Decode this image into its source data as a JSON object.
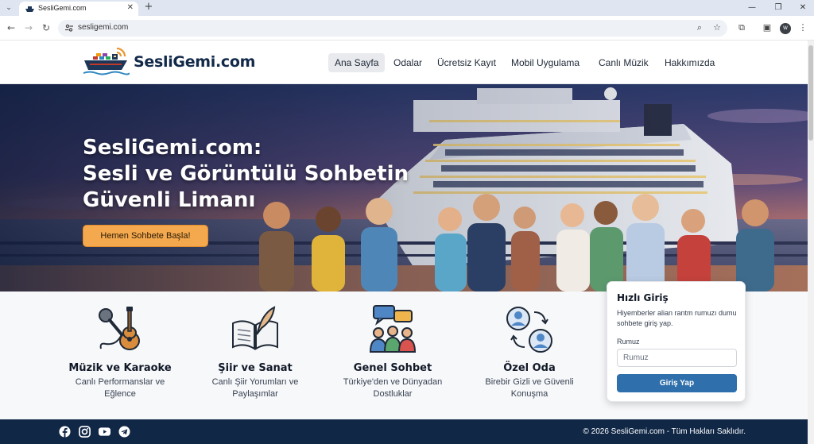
{
  "browser": {
    "tab_title": "SesliGemi.com",
    "url": "sesligemi.com",
    "profile_initials": "W"
  },
  "site": {
    "logo_text": "SesliGemi.com",
    "nav": [
      "Ana Sayfa",
      "Odalar",
      "Ücretsiz Kayıt",
      "Mobil Uygulama",
      "Canlı Müzik",
      "Hakkımızda"
    ],
    "active_nav": "Ana Sayfa"
  },
  "hero": {
    "title_lines": [
      "SesliGemi.com:",
      "Sesli ve Görüntülü Sohbetin",
      "Güvenli Limanı"
    ],
    "cta_label": "Hemen Sohbete Başla!"
  },
  "features": [
    {
      "title": "Müzik ve Karaoke",
      "desc_lines": [
        "Canlı Performanslar ve",
        "Eğlence"
      ],
      "icon": "microphone-guitar-icon"
    },
    {
      "title": "Şiir ve Sanat",
      "desc_lines": [
        "Canlı Şiir Yorumları ve",
        "Paylaşımlar"
      ],
      "icon": "book-quill-icon"
    },
    {
      "title": "Genel Sohbet",
      "desc_lines": [
        "Türkiye'den ve Dünyadan",
        "Dostluklar"
      ],
      "icon": "group-chat-icon"
    },
    {
      "title": "Özel Oda",
      "desc_lines": [
        "Birebir Gizli ve Güvenli",
        "Konuşma"
      ],
      "icon": "private-room-icon"
    }
  ],
  "quick_login": {
    "title": "Hızlı Giriş",
    "description": "Hiyemberler alian rantm rumuzı dumu sohbete giriş yap.",
    "label": "Rumuz",
    "placeholder": "Rumuz",
    "button_label": "Giriş Yap"
  },
  "footer": {
    "social_icons": [
      "facebook-icon",
      "instagram-icon",
      "youtube-icon",
      "telegram-icon"
    ],
    "copyright": "© 2026 SesliGemi.com - Tüm Hakları Saklıdır."
  },
  "colors": {
    "navy": "#102746",
    "accent_orange": "#f4a94e",
    "button_blue": "#2f6fab"
  }
}
